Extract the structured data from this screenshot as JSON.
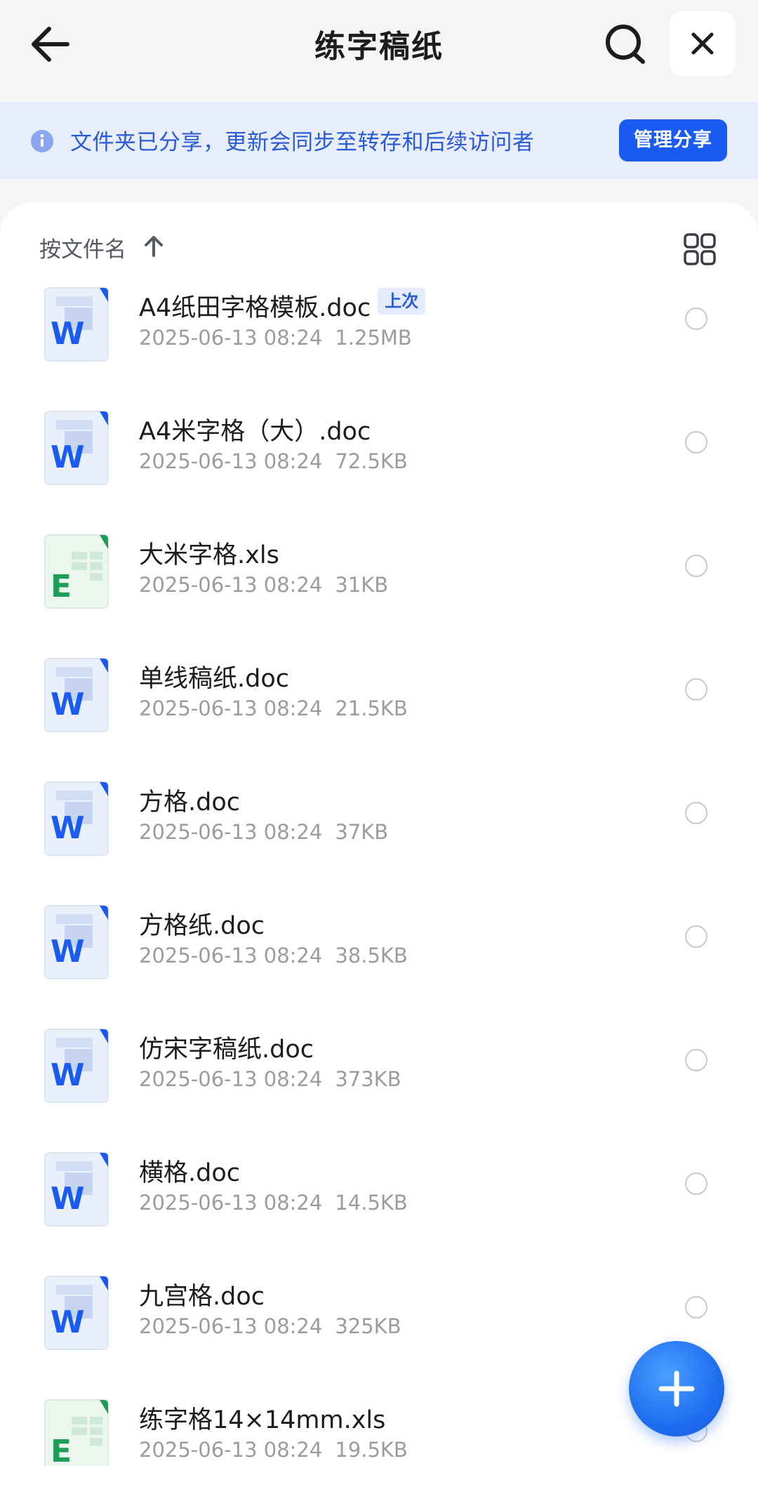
{
  "header": {
    "title": "练字稿纸",
    "back_icon": "arrow-left-icon",
    "search_icon": "search-icon",
    "close_icon": "close-icon"
  },
  "banner": {
    "text": "文件夹已分享，更新会同步至转存和后续访问者",
    "button_label": "管理分享",
    "accent": "#1a5cf2"
  },
  "sort": {
    "label": "按文件名",
    "arrow_icon": "arrow-up-icon",
    "view_icon": "grid-view-icon"
  },
  "files": [
    {
      "name": "A4纸田字格模板.doc",
      "badge": "上次",
      "date": "2025-06-13 08:24",
      "size": "1.25MB",
      "type": "word"
    },
    {
      "name": "A4米字格（大）.doc",
      "date": "2025-06-13 08:24",
      "size": "72.5KB",
      "type": "word"
    },
    {
      "name": "大米字格.xls",
      "date": "2025-06-13 08:24",
      "size": "31KB",
      "type": "excel"
    },
    {
      "name": "单线稿纸.doc",
      "date": "2025-06-13 08:24",
      "size": "21.5KB",
      "type": "word"
    },
    {
      "name": "方格.doc",
      "date": "2025-06-13 08:24",
      "size": "37KB",
      "type": "word"
    },
    {
      "name": "方格纸.doc",
      "date": "2025-06-13 08:24",
      "size": "38.5KB",
      "type": "word"
    },
    {
      "name": "仿宋字稿纸.doc",
      "date": "2025-06-13 08:24",
      "size": "373KB",
      "type": "word"
    },
    {
      "name": "横格.doc",
      "date": "2025-06-13 08:24",
      "size": "14.5KB",
      "type": "word"
    },
    {
      "name": "九宫格.doc",
      "date": "2025-06-13 08:24",
      "size": "325KB",
      "type": "word"
    },
    {
      "name": "练字格14×14mm.xls",
      "date": "2025-06-13 08:24",
      "size": "19.5KB",
      "type": "excel"
    }
  ],
  "fab": {
    "icon": "plus-icon"
  }
}
